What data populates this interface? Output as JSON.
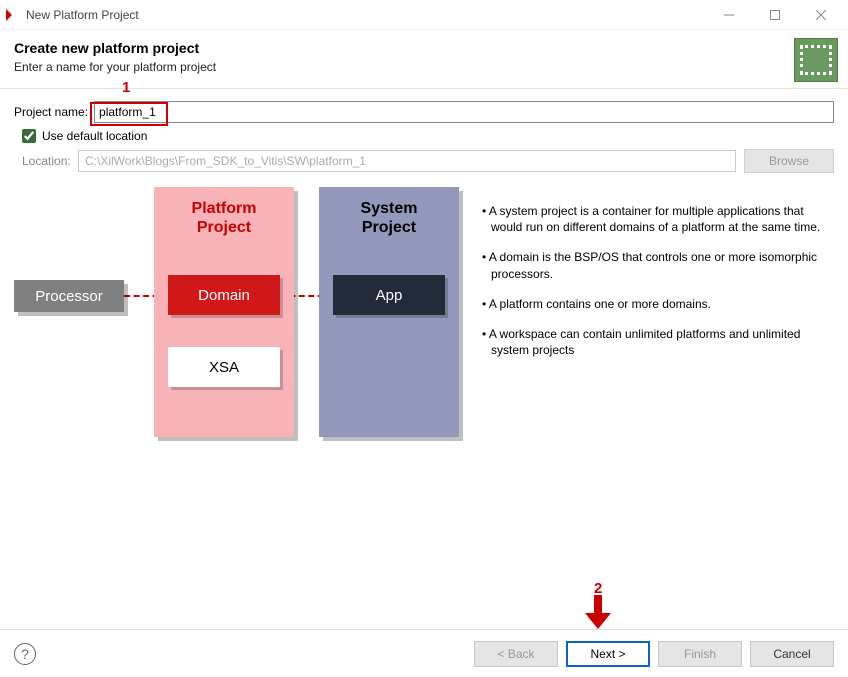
{
  "window": {
    "title": "New Platform Project",
    "min_tooltip": "Minimize",
    "max_tooltip": "Maximize",
    "close_tooltip": "Close"
  },
  "header": {
    "title": "Create new platform project",
    "subtitle": "Enter a name for your platform project"
  },
  "form": {
    "project_name_label": "Project name:",
    "project_name_value": "platform_1",
    "use_default_location_label": "Use default location",
    "use_default_location_checked": true,
    "location_label": "Location:",
    "location_value": "C:\\XilWork\\Blogs\\From_SDK_to_Vitis\\SW\\platform_1",
    "browse_label": "Browse"
  },
  "diagram": {
    "processor": "Processor",
    "platform_project_line1": "Platform",
    "platform_project_line2": "Project",
    "domain": "Domain",
    "xsa": "XSA",
    "system_project_line1": "System",
    "system_project_line2": "Project",
    "app": "App"
  },
  "bullets": [
    "• A system project is a container for multiple applications that would run on different domains of a platform at the same time.",
    "• A domain is the BSP/OS that controls one or more isomorphic processors.",
    "• A platform contains one or more domains.",
    "• A workspace can contain unlimited platforms and unlimited system projects"
  ],
  "annotations": {
    "step1": "1",
    "step2": "2"
  },
  "footer": {
    "back": "< Back",
    "next": "Next >",
    "finish": "Finish",
    "cancel": "Cancel"
  }
}
